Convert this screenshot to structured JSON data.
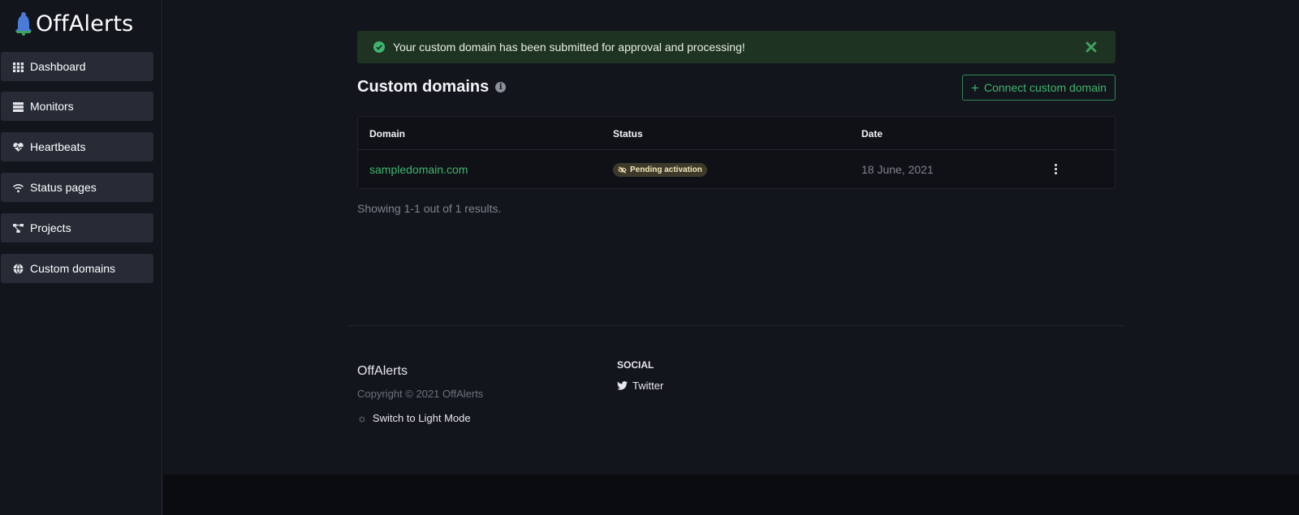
{
  "brand": {
    "name": "OffAlerts"
  },
  "sidebar": {
    "items": [
      {
        "label": "Dashboard",
        "icon": "grid-icon"
      },
      {
        "label": "Monitors",
        "icon": "server-icon"
      },
      {
        "label": "Heartbeats",
        "icon": "heartbeat-icon"
      },
      {
        "label": "Status pages",
        "icon": "wifi-icon"
      },
      {
        "label": "Projects",
        "icon": "project-diagram-icon"
      },
      {
        "label": "Custom domains",
        "icon": "globe-icon"
      }
    ]
  },
  "alert": {
    "message": "Your custom domain has been submitted for approval and processing!",
    "type": "success"
  },
  "page": {
    "title": "Custom domains",
    "connect_button": "Connect custom domain"
  },
  "table": {
    "headers": {
      "domain": "Domain",
      "status": "Status",
      "date": "Date"
    },
    "rows": [
      {
        "domain": "sampledomain.com",
        "status": "Pending activation",
        "date": "18 June, 2021"
      }
    ],
    "results_text": "Showing 1-1 out of 1 results."
  },
  "footer": {
    "brand": "OffAlerts",
    "copyright": "Copyright © 2021 OffAlerts",
    "light_mode": "Switch to Light Mode",
    "social_title": "SOCIAL",
    "twitter": "Twitter"
  },
  "colors": {
    "accent": "#3fb56f",
    "sidebar_item_bg": "#262b36",
    "alert_bg": "#1f3322",
    "badge_bg": "#3d3a2b"
  }
}
